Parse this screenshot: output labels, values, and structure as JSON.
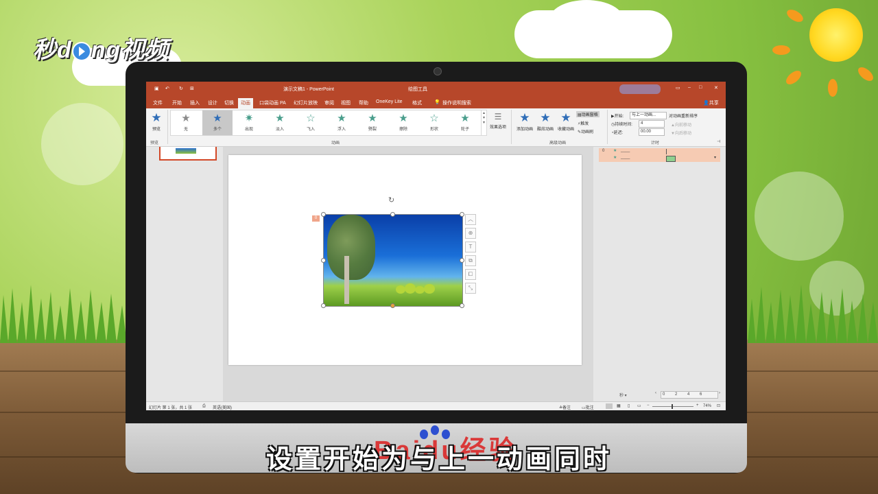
{
  "branding": {
    "logo_text_a": "秒d",
    "logo_text_b": "ng视频"
  },
  "video": {
    "subtitle": "设置开始为与上一动画同时",
    "watermark": "Baidu经验"
  },
  "app": {
    "title": "演示文稿1 - PowerPoint",
    "context_tab_group": "绘图工具",
    "tabs": [
      "文件",
      "开始",
      "插入",
      "设计",
      "切换",
      "动画",
      "口袋动画 PA",
      "幻灯片放映",
      "审阅",
      "视图",
      "帮助",
      "OneKey Lite",
      "格式"
    ],
    "active_tab": "动画",
    "search_placeholder": "操作说明搜索",
    "share_label": "共享"
  },
  "ribbon": {
    "preview_label": "预览",
    "preview_group": "预览",
    "animations": [
      "无",
      "多个",
      "出现",
      "淡入",
      "飞入",
      "浮入",
      "劈裂",
      "擦除",
      "形状",
      "轮子"
    ],
    "selected_animation": "多个",
    "effect_options": "效果选项",
    "animation_group": "动画",
    "add_animation": "添加动画",
    "painter_animation": "酷炫动画",
    "favorite_animation": "收藏动画",
    "animation_pane": "动画窗格",
    "trigger": "触发",
    "animation_painter": "动画刷",
    "advanced_group": "高级动画",
    "start_label": "开始:",
    "start_value": "与上一动画...",
    "duration_label": "持续时间:",
    "duration_value": "4",
    "delay_label": "延迟:",
    "delay_value": "00.00",
    "reorder_title": "对动画重新排序",
    "move_earlier": "向前移动",
    "move_later": "向后移动",
    "timing_group": "计时"
  },
  "slide": {
    "badge": "0"
  },
  "anim_pane": {
    "rows": [
      {
        "index": "0",
        "star": "★",
        "name": "____"
      },
      {
        "index": "",
        "star": "★",
        "name": "____"
      }
    ],
    "seconds_label": "秒 ▾",
    "timeline_ticks": [
      "0",
      "2",
      "4",
      "6"
    ]
  },
  "status": {
    "slide_info": "幻灯片 第 1 张，共 1 张",
    "language": "英语(美国)",
    "notes": "备注",
    "comments": "批注",
    "zoom": "74%"
  }
}
